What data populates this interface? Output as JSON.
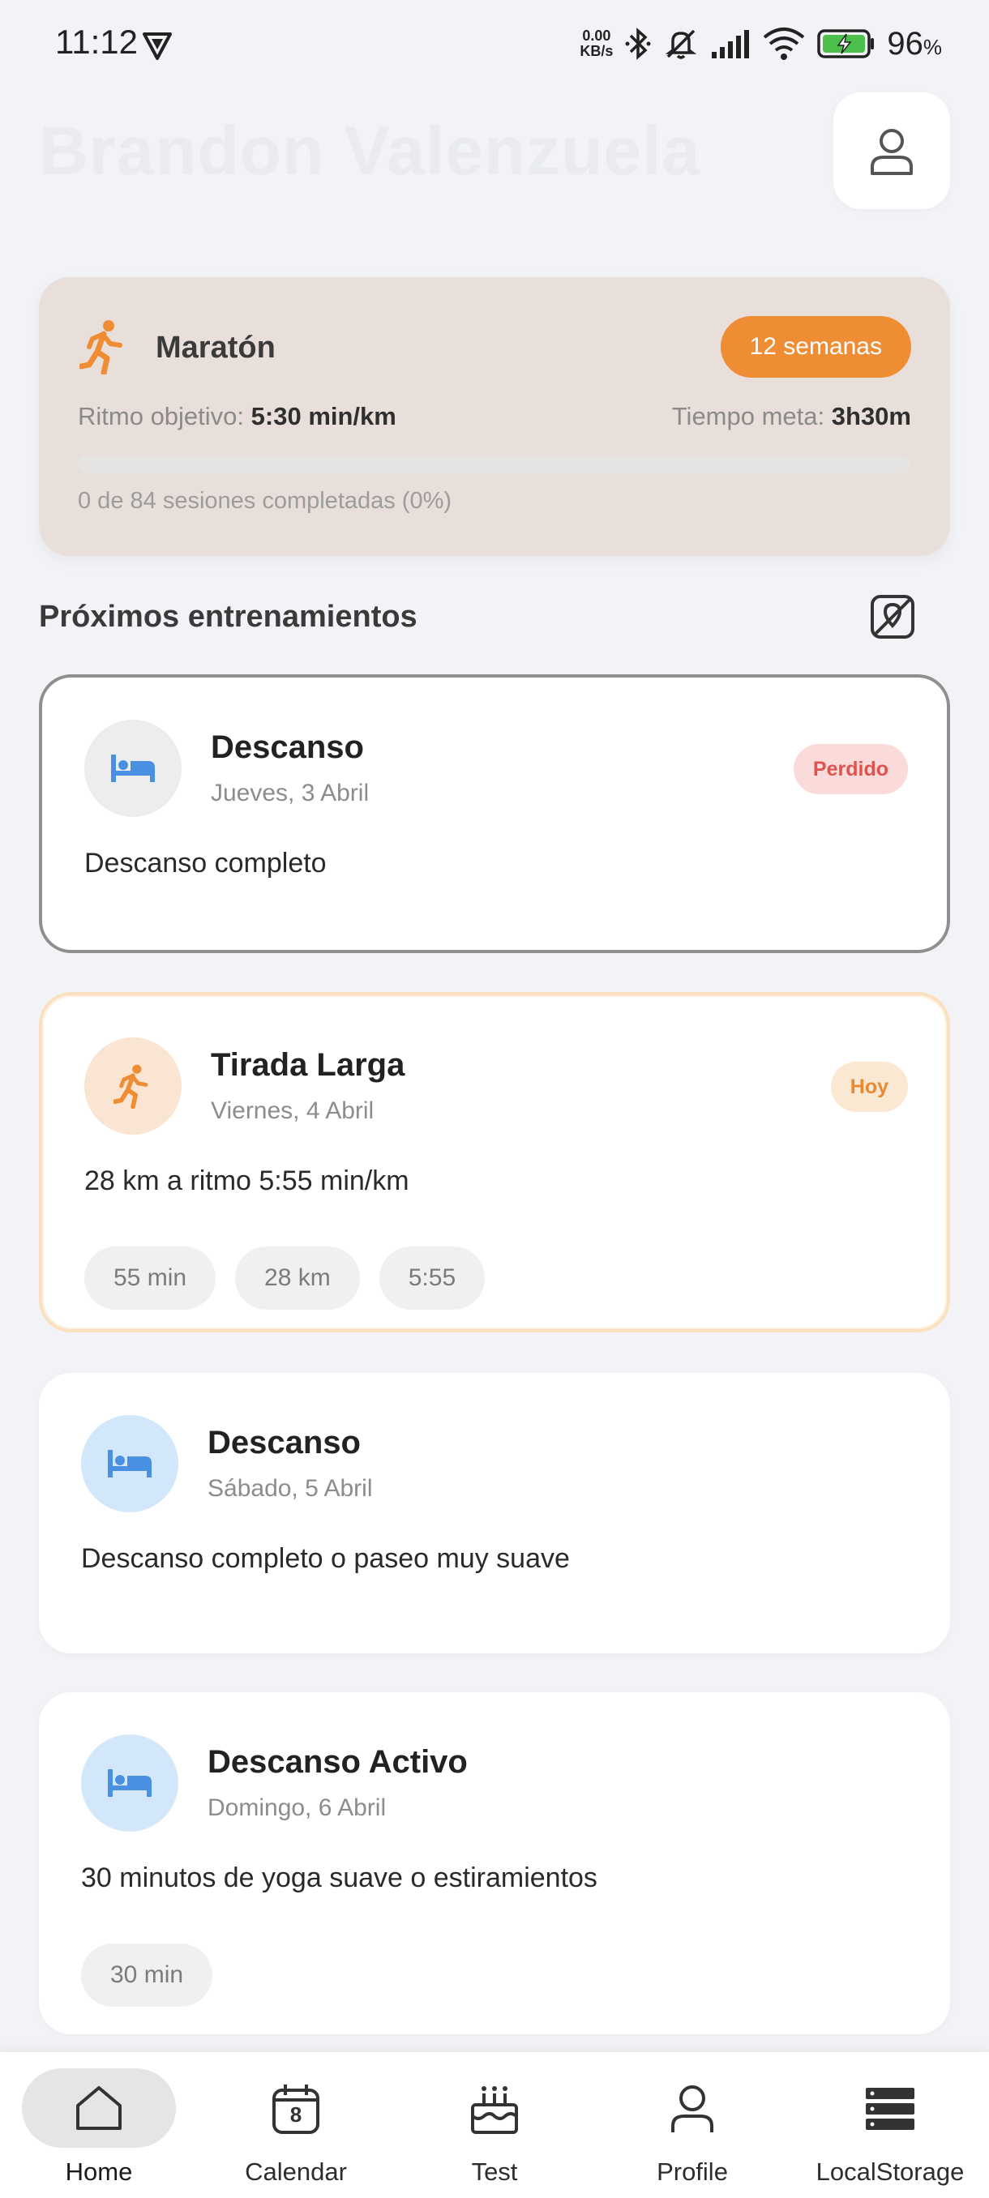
{
  "status_bar": {
    "time": "11:12",
    "speed_value": "0.00",
    "speed_unit": "KB/s",
    "battery": "96",
    "battery_unit": "%"
  },
  "header": {
    "user_name": "Brandon Valenzuela",
    "profile_icon": "user-icon"
  },
  "plan": {
    "title": "Maratón",
    "weeks_badge": "12 semanas",
    "pace_label": "Ritmo objetivo:",
    "pace_value": "5:30 min/km",
    "goal_label": "Tiempo meta:",
    "goal_value": "3h30m",
    "progress_fraction": 0,
    "progress_text": "0 de 84 sesiones completadas (0%)",
    "accent_color": "#ef8d35"
  },
  "section": {
    "title": "Próximos entrenamientos",
    "map_icon": "map-off-icon"
  },
  "workouts": [
    {
      "title": "Descanso",
      "date": "Jueves, 3 Abril",
      "description": "Descanso completo",
      "status": "Perdido",
      "icon": "bed-icon"
    },
    {
      "title": "Tirada Larga",
      "date": "Viernes, 4 Abril",
      "description": "28 km a ritmo 5:55 min/km",
      "status": "Hoy",
      "icon": "running-icon",
      "chips": [
        "55 min",
        "28 km",
        "5:55"
      ]
    },
    {
      "title": "Descanso",
      "date": "Sábado, 5 Abril",
      "description": "Descanso completo o paseo muy suave",
      "icon": "bed-icon"
    },
    {
      "title": "Descanso Activo",
      "date": "Domingo, 6 Abril",
      "description": "30 minutos de yoga suave o estiramientos",
      "icon": "bed-icon",
      "chips": [
        "30 min"
      ]
    }
  ],
  "nav": {
    "items": [
      {
        "label": "Home",
        "icon": "home-icon",
        "active": true
      },
      {
        "label": "Calendar",
        "icon": "calendar-icon",
        "calendar_day": "8"
      },
      {
        "label": "Test",
        "icon": "cake-icon"
      },
      {
        "label": "Profile",
        "icon": "user-icon"
      },
      {
        "label": "LocalStorage",
        "icon": "storage-icon"
      }
    ]
  }
}
